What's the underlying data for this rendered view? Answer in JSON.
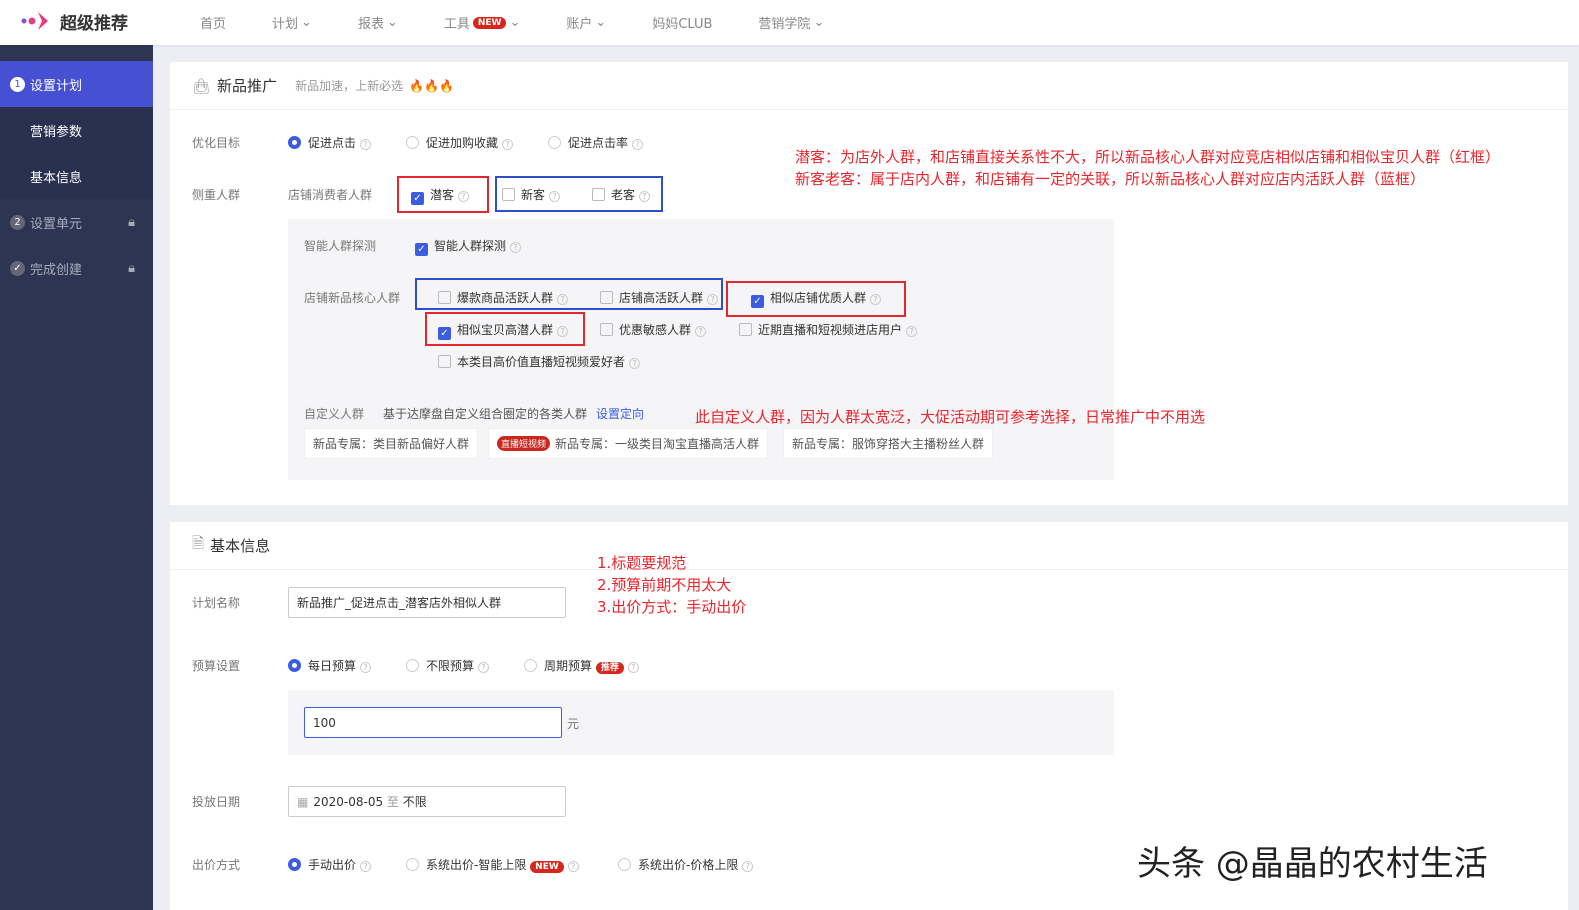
{
  "header": {
    "logo": "超级推荐",
    "nav": [
      "首页",
      "计划",
      "报表",
      "工具",
      "账户",
      "妈妈CLUB",
      "营销学院"
    ],
    "new_badge": "NEW"
  },
  "sidebar": {
    "steps": [
      {
        "num": "1",
        "label": "设置计划"
      },
      {
        "label": "营销参数"
      },
      {
        "label": "基本信息"
      },
      {
        "num": "2",
        "label": "设置单元"
      },
      {
        "label": "完成创建"
      }
    ]
  },
  "section1": {
    "title": "新品推广",
    "subtitle": "新品加速，上新必选",
    "goal_label": "优化目标",
    "goals": [
      "促进点击",
      "促进加购收藏",
      "促进点击率"
    ],
    "crowd_label": "侧重人群",
    "consumer_label": "店铺消费者人群",
    "consumers": [
      "潜客",
      "新客",
      "老客"
    ],
    "smart_label": "智能人群探测",
    "smart_option": "智能人群探测",
    "core_label": "店铺新品核心人群",
    "core_options": [
      "爆款商品活跃人群",
      "店铺高活跃人群",
      "相似店铺优质人群",
      "相似宝贝高潜人群",
      "优惠敏感人群",
      "近期直播和短视频进店用户",
      "本类目高价值直播短视频爱好者"
    ],
    "custom_label": "自定义人群",
    "custom_desc": "基于达摩盘自定义组合圈定的各类人群",
    "custom_link": "设置定向",
    "tags": [
      "新品专属：类目新品偏好人群",
      "新品专属：一级类目淘宝直播高活人群",
      "新品专属：服饰穿搭大主播粉丝人群"
    ],
    "tag_badge": "直播短视频"
  },
  "section2": {
    "title": "基本信息",
    "name_label": "计划名称",
    "name_value": "新品推广_促进点击_潜客店外相似人群",
    "budget_label": "预算设置",
    "budgets": [
      "每日预算",
      "不限预算",
      "周期预算"
    ],
    "recommend": "推荐",
    "budget_value": "100",
    "unit": "元",
    "date_label": "投放日期",
    "date_start": "2020-08-05",
    "date_sep": "至",
    "date_end": "不限",
    "bid_label": "出价方式",
    "bids": [
      "手动出价",
      "系统出价-智能上限",
      "系统出价-价格上限"
    ]
  },
  "annotations": {
    "a1": "潜客：为店外人群，和店铺直接关系性不大，所以新品核心人群对应竞店相似店铺和相似宝贝人群（红框）",
    "a2": "新客老客：属于店内人群，和店铺有一定的关联，所以新品核心人群对应店内活跃人群（蓝框）",
    "a3": "此自定义人群，因为人群太宽泛，大促活动期可参考选择，日常推广中不用选",
    "a4": "1.标题要规范",
    "a5": "2.预算前期不用太大",
    "a6": "3.出价方式：手动出价"
  },
  "watermark": "头条 @晶晶的农村生活"
}
